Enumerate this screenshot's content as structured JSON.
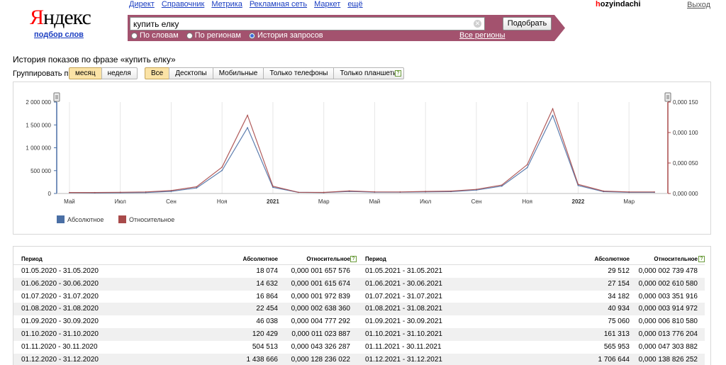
{
  "logo": {
    "text_red": "Я",
    "text_black": "ндекс",
    "sub": "подбор слов"
  },
  "topnav": [
    "Директ",
    "Справочник",
    "Метрика",
    "Рекламная сеть",
    "Маркет",
    "ещё"
  ],
  "user": {
    "name_first": "h",
    "name_rest": "ozyindachi",
    "logout": "Выход"
  },
  "search": {
    "value": "купить елку",
    "submit": "Подобрать",
    "modes": [
      {
        "label": "По словам",
        "selected": false
      },
      {
        "label": "По регионам",
        "selected": false
      },
      {
        "label": "История запросов",
        "selected": true
      }
    ],
    "regions_link": "Все регионы"
  },
  "history_title": "История показов по фразе «купить елку»",
  "group_by": {
    "label": "Группировать по:",
    "options": [
      {
        "label": "месяц",
        "selected": true
      },
      {
        "label": "неделя",
        "selected": false
      }
    ]
  },
  "device_filter": [
    {
      "label": "Все",
      "selected": true
    },
    {
      "label": "Десктопы",
      "selected": false
    },
    {
      "label": "Мобильные",
      "selected": false
    },
    {
      "label": "Только телефоны",
      "selected": false
    },
    {
      "label": "Только планшеты",
      "selected": false
    }
  ],
  "help_glyph": "?",
  "colors": {
    "absolute": "#4a6fa5",
    "relative": "#a84a4a",
    "brand": "#a3526e"
  },
  "chart_data": {
    "type": "line",
    "x_tick_labels": [
      "Май",
      "Июл",
      "Сен",
      "Ноя",
      "2021",
      "Мар",
      "Май",
      "Июл",
      "Сен",
      "Ноя",
      "2022",
      "Мар"
    ],
    "y_left_ticks": [
      "2 000 000",
      "1 500 000",
      "1 000 000",
      "500 000",
      "0"
    ],
    "y_right_ticks": [
      "0,000 150",
      "0,000 100",
      "0,000 050",
      "0,000 000"
    ],
    "y_left_range": [
      0,
      2000000
    ],
    "y_right_range": [
      0,
      0.00015
    ],
    "x": [
      "2020-05",
      "2020-06",
      "2020-07",
      "2020-08",
      "2020-09",
      "2020-10",
      "2020-11",
      "2020-12",
      "2021-01",
      "2021-02",
      "2021-03",
      "2021-04",
      "2021-05",
      "2021-06",
      "2021-07",
      "2021-08",
      "2021-09",
      "2021-10",
      "2021-11",
      "2021-12",
      "2022-01",
      "2022-02",
      "2022-03",
      "2022-04"
    ],
    "series": [
      {
        "name": "Абсолютное",
        "axis": "left",
        "values": [
          18074,
          14632,
          16864,
          22454,
          46038,
          120429,
          504513,
          1438666,
          135000,
          25000,
          20000,
          45000,
          29512,
          27154,
          34182,
          40934,
          75060,
          161313,
          565953,
          1706644,
          175000,
          40000,
          25000,
          25000
        ]
      },
      {
        "name": "Относительное",
        "axis": "right",
        "values": [
          1.6e-06,
          1.6e-06,
          2e-06,
          2.6e-06,
          4.8e-06,
          1.1e-05,
          4.33e-05,
          0.0001282,
          1.2e-05,
          2e-06,
          1.8e-06,
          4.2e-06,
          2.7e-06,
          2.6e-06,
          3.4e-06,
          3.9e-06,
          6.8e-06,
          1.38e-05,
          4.73e-05,
          0.0001389,
          1.5e-05,
          4e-06,
          2.5e-06,
          2.5e-06
        ]
      }
    ],
    "legend": [
      "Абсолютное",
      "Относительное"
    ],
    "legend_position": "bottom-left",
    "grid": true
  },
  "table": {
    "headers": {
      "period": "Период",
      "absolute": "Абсолютное",
      "relative": "Относительное"
    },
    "left": [
      [
        "01.05.2020 - 31.05.2020",
        "18 074",
        "0,000 001 657 576"
      ],
      [
        "01.06.2020 - 30.06.2020",
        "14 632",
        "0,000 001 615 674"
      ],
      [
        "01.07.2020 - 31.07.2020",
        "16 864",
        "0,000 001 972 839"
      ],
      [
        "01.08.2020 - 31.08.2020",
        "22 454",
        "0,000 002 638 360"
      ],
      [
        "01.09.2020 - 30.09.2020",
        "46 038",
        "0,000 004 777 292"
      ],
      [
        "01.10.2020 - 31.10.2020",
        "120 429",
        "0,000 011 023 887"
      ],
      [
        "01.11.2020 - 30.11.2020",
        "504 513",
        "0,000 043 326 287"
      ],
      [
        "01.12.2020 - 31.12.2020",
        "1 438 666",
        "0,000 128 236 022"
      ]
    ],
    "right": [
      [
        "01.05.2021 - 31.05.2021",
        "29 512",
        "0,000 002 739 478"
      ],
      [
        "01.06.2021 - 30.06.2021",
        "27 154",
        "0,000 002 610 580"
      ],
      [
        "01.07.2021 - 31.07.2021",
        "34 182",
        "0,000 003 351 916"
      ],
      [
        "01.08.2021 - 31.08.2021",
        "40 934",
        "0,000 003 914 972"
      ],
      [
        "01.09.2021 - 30.09.2021",
        "75 060",
        "0,000 006 810 580"
      ],
      [
        "01.10.2021 - 31.10.2021",
        "161 313",
        "0,000 013 776 204"
      ],
      [
        "01.11.2021 - 30.11.2021",
        "565 953",
        "0,000 047 303 882"
      ],
      [
        "01.12.2021 - 31.12.2021",
        "1 706 644",
        "0,000 138 826 252"
      ]
    ]
  }
}
